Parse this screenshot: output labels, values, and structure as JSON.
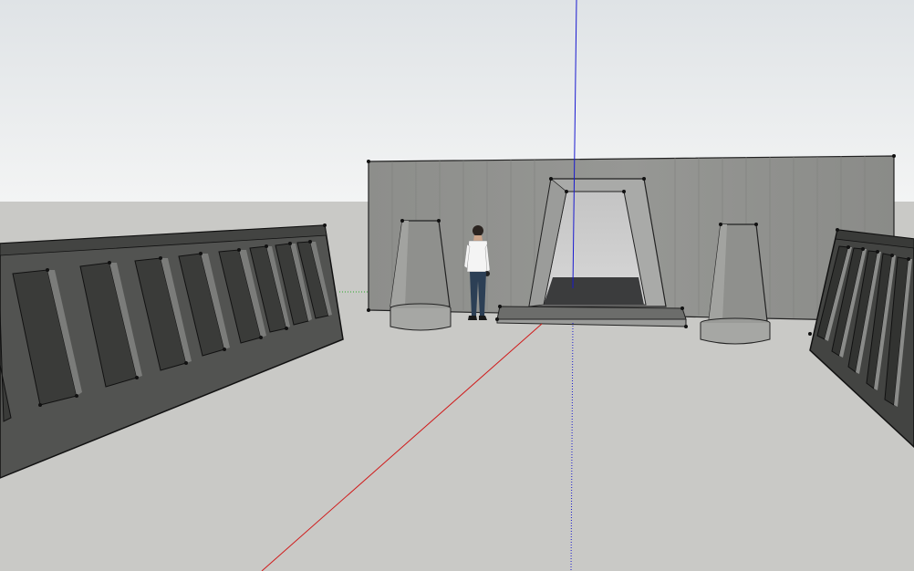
{
  "app": {
    "view": "3d-modeling-viewport"
  },
  "scene": {
    "sky_top_color": "#dfe3e6",
    "sky_bottom_color": "#f3f4f4",
    "ground_color": "#c9c9c6",
    "wall_color": "#8f908d",
    "dark_wall_color": "#555654",
    "axis_colors": {
      "red_axis": "#d01a1a",
      "green_axis": "#1e9e1e",
      "blue_axis": "#1a1ad0"
    },
    "objects": [
      "back-wall",
      "doorway-arch",
      "door-step-platform",
      "tapered-column-left",
      "tapered-column-right",
      "slotted-wall-left",
      "slotted-wall-right",
      "scale-figure-person"
    ]
  }
}
